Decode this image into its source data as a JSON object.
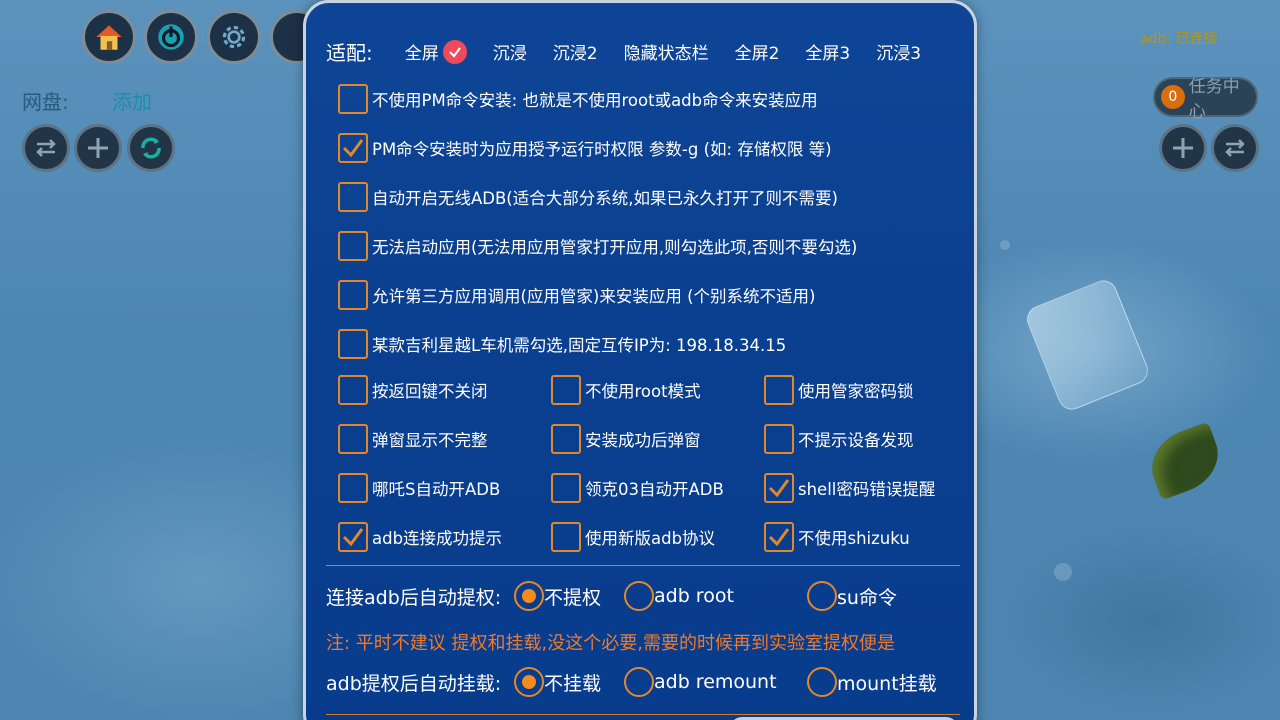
{
  "background": {
    "net_disk_label": "网盘:",
    "add_label": "添加",
    "adb_status": "adb: 已连接",
    "task_center": {
      "count": "0",
      "label": "任务中心"
    }
  },
  "fit": {
    "label": "适配:",
    "options": [
      "全屏",
      "沉浸",
      "沉浸2",
      "隐藏状态栏",
      "全屏2",
      "全屏3",
      "沉浸3"
    ],
    "selected": "全屏"
  },
  "long_options": [
    {
      "label": "不使用PM命令安装: 也就是不使用root或adb命令来安装应用",
      "checked": false
    },
    {
      "label": "PM命令安装时为应用授予运行时权限 参数-g (如: 存储权限 等)",
      "checked": true
    },
    {
      "label": "自动开启无线ADB(适合大部分系统,如果已永久打开了则不需要)",
      "checked": false
    },
    {
      "label": "无法启动应用(无法用应用管家打开应用,则勾选此项,否则不要勾选)",
      "checked": false
    },
    {
      "label": "允许第三方应用调用(应用管家)来安装应用 (个别系统不适用)",
      "checked": false
    },
    {
      "label": "某款吉利星越L车机需勾选,固定互传IP为: 198.18.34.15",
      "checked": false
    }
  ],
  "grid_options": [
    [
      {
        "label": "按返回键不关闭",
        "checked": false
      },
      {
        "label": "不使用root模式",
        "checked": false
      },
      {
        "label": "使用管家密码锁",
        "checked": false
      }
    ],
    [
      {
        "label": "弹窗显示不完整",
        "checked": false
      },
      {
        "label": "安装成功后弹窗",
        "checked": false
      },
      {
        "label": "不提示设备发现",
        "checked": false
      }
    ],
    [
      {
        "label": "哪吒S自动开ADB",
        "checked": false
      },
      {
        "label": "领克03自动开ADB",
        "checked": false
      },
      {
        "label": "shell密码错误提醒",
        "checked": true
      }
    ],
    [
      {
        "label": "adb连接成功提示",
        "checked": true
      },
      {
        "label": "使用新版adb协议",
        "checked": false
      },
      {
        "label": "不使用shizuku",
        "checked": true
      }
    ]
  ],
  "auto_root": {
    "label": "连接adb后自动提权:",
    "options": [
      "不提权",
      "adb root",
      "su命令"
    ],
    "selected": "不提权"
  },
  "note": "注: 平时不建议 提权和挂载,没这个必要,需要的时候再到实验室提权便是",
  "auto_mount": {
    "label": "adb提权后自动挂载:",
    "options": [
      "不挂载",
      "adb remount",
      "mount挂载"
    ],
    "selected": "不挂载"
  },
  "colors": {
    "dialog_bg": "#0a3f8f",
    "accent_orange": "#e3882a",
    "note_orange": "#f07a2a",
    "check_red": "#ef4a5b"
  }
}
